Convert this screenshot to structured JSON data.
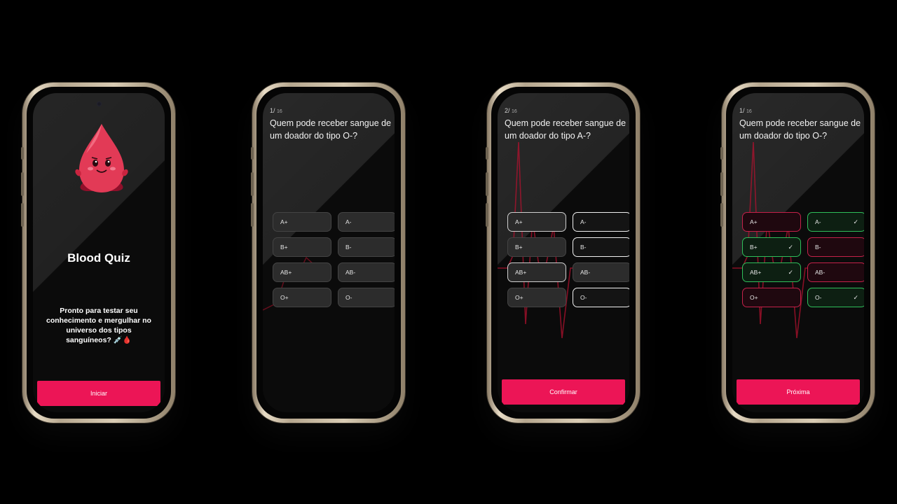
{
  "colors": {
    "accent": "#ec1556",
    "correct": "#2fbf5a",
    "wrong": "#c5214a",
    "background": "#000000"
  },
  "screens": {
    "home": {
      "mascot_icon": "blood-drop-mascot-icon",
      "title": "Blood Quiz",
      "subtitle": "Pronto para testar seu conhecimento e mergulhar no universo dos tipos sanguíneos? 💉🩸",
      "button_label": "Iniciar"
    },
    "quiz1": {
      "counter_current": "1/",
      "counter_total": "16",
      "question": "Quem pode receber sangue de um doador do tipo O-?",
      "options": [
        "A+",
        "A-",
        "B+",
        "B-",
        "AB+",
        "AB-",
        "O+",
        "O-"
      ]
    },
    "quiz2": {
      "counter_current": "2/",
      "counter_total": "16",
      "question": "Quem pode receber sangue de um doador do tipo A-?",
      "options": [
        "A+",
        "A-",
        "B+",
        "B-",
        "AB+",
        "AB-",
        "O+",
        "O-"
      ],
      "selected": [
        "A+",
        "A-",
        "B-",
        "AB+",
        "O-"
      ],
      "button_label": "Confirmar"
    },
    "quiz3": {
      "counter_current": "1/",
      "counter_total": "16",
      "question": "Quem pode receber sangue de um doador do tipo O-?",
      "options": [
        "A+",
        "A-",
        "B+",
        "B-",
        "AB+",
        "AB-",
        "O+",
        "O-"
      ],
      "correct": [
        "A-",
        "B+",
        "AB+",
        "O-"
      ],
      "check_icon": "checkmark-icon",
      "check_glyph": "✓",
      "button_label": "Próxima"
    }
  }
}
